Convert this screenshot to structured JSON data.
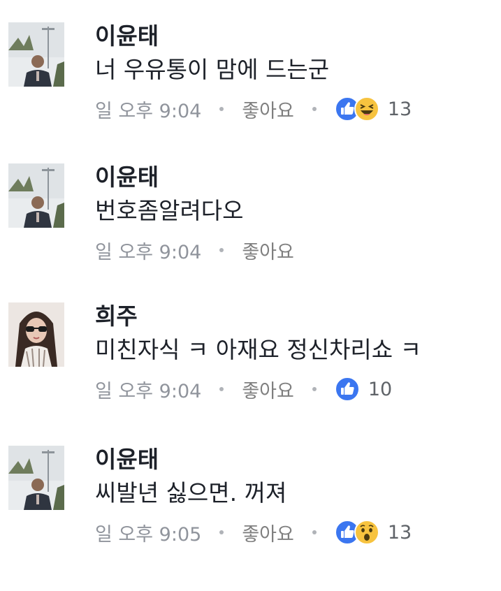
{
  "comments": [
    {
      "author": "이윤태",
      "text": "너 우유통이 맘에 드는군",
      "time": "일 오후 9:04",
      "like_label": "좋아요",
      "reactions": [
        "like-icon",
        "haha-icon"
      ],
      "reaction_count": "13"
    },
    {
      "author": "이윤태",
      "text": "번호좀알려다오",
      "time": "일 오후 9:04",
      "like_label": "좋아요"
    },
    {
      "author": "희주",
      "text": "미친자식 ㅋ 아재요 정신차리쇼 ㅋ",
      "time": "일 오후 9:04",
      "like_label": "좋아요",
      "reactions": [
        "like-icon"
      ],
      "reaction_count": "10"
    },
    {
      "author": "이윤태",
      "text": "씨발년 싫으면. 꺼져",
      "time": "일 오후 9:05",
      "like_label": "좋아요",
      "reactions": [
        "like-icon",
        "wow-icon"
      ],
      "reaction_count": "13"
    }
  ],
  "colors": {
    "like_blue": "#3b76f0",
    "emoji_yellow": "#f7c33f",
    "meta_gray": "#90949c"
  }
}
